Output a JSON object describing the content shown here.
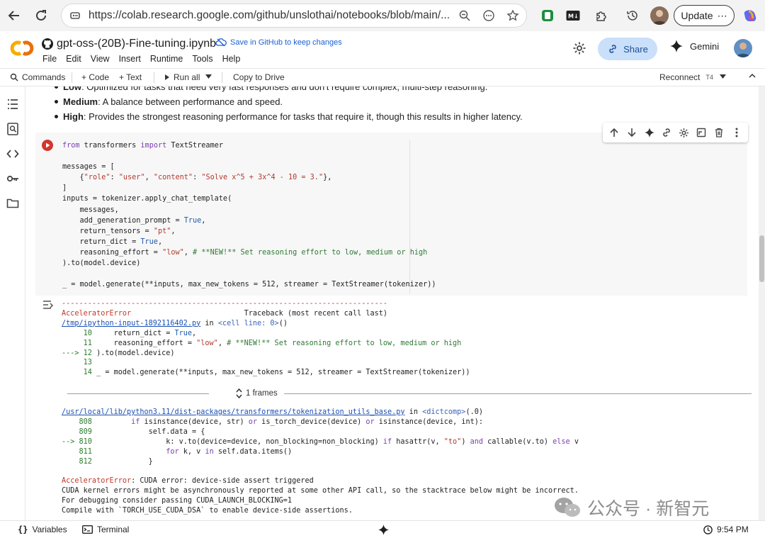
{
  "browser": {
    "url": "https://colab.research.google.com/github/unslothai/notebooks/blob/main/...",
    "update_label": "Update",
    "update_more": "⋯"
  },
  "notebook": {
    "title": "gpt-oss-(20B)-Fine-tuning.ipynb",
    "save_github": "Save in GitHub to keep changes",
    "menu": [
      "File",
      "Edit",
      "View",
      "Insert",
      "Runtime",
      "Tools",
      "Help"
    ],
    "share_label": "Share",
    "gemini_label": "Gemini"
  },
  "toolbar": {
    "commands": "Commands",
    "code": "+ Code",
    "text": "+ Text",
    "run_all": "Run all",
    "copy_to_drive": "Copy to Drive",
    "reconnect": "Reconnect",
    "runtime": "T4"
  },
  "markdown": {
    "bullets": [
      {
        "bold": "Low",
        "text": ": Optimized for tasks that need very fast responses and don't require complex, multi-step reasoning."
      },
      {
        "bold": "Medium",
        "text": ": A balance between performance and speed."
      },
      {
        "bold": "High",
        "text": ": Provides the strongest reasoning performance for tasks that require it, though this results in higher latency."
      }
    ]
  },
  "output": {
    "frames_label": "1 frames"
  },
  "statusbar": {
    "variables": "Variables",
    "terminal": "Terminal",
    "time": "9:54 PM"
  },
  "watermark": {
    "text": "公众号 · 新智元"
  },
  "colors": {
    "accent": "#1a5fd6",
    "run_button": "#d2362e",
    "error_text": "#c0392b",
    "share_bg": "#c9dffa",
    "logo_orange": "#f9ab00",
    "logo_dark": "#e8710a"
  }
}
